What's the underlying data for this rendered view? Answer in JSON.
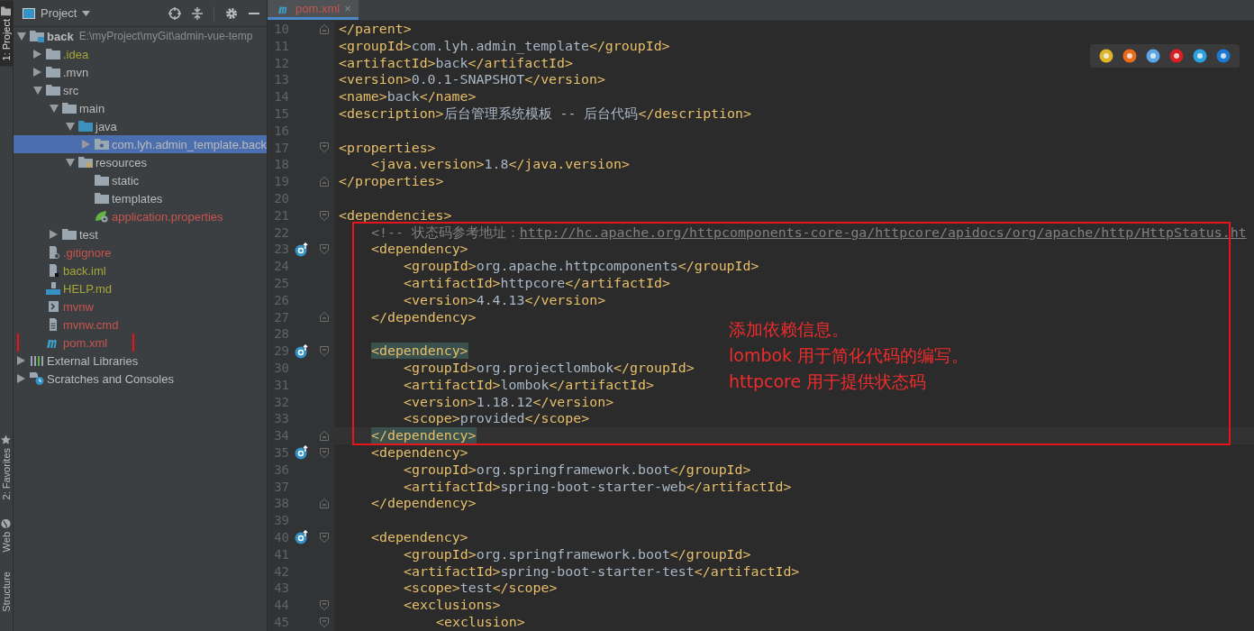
{
  "tool_strip": [
    {
      "label": "1: Project",
      "selected": true
    },
    {
      "label": "2: Favorites",
      "selected": false
    },
    {
      "label": "Web",
      "selected": false
    },
    {
      "label": "Structure",
      "selected": false
    }
  ],
  "project_panel": {
    "title": "Project",
    "tree": [
      {
        "label": "back",
        "path": "E:\\myProject\\myGit\\admin-vue-temp",
        "kind": "module",
        "color": "#bbbbbb",
        "expanded": true,
        "selected": false,
        "children": [
          {
            "label": ".idea",
            "kind": "folder",
            "color": "#a6a636",
            "expanded": false,
            "selected": false
          },
          {
            "label": ".mvn",
            "kind": "folder",
            "color": "#bbbbbb",
            "expanded": false,
            "selected": false
          },
          {
            "label": "src",
            "kind": "folder",
            "color": "#bbbbbb",
            "expanded": true,
            "selected": false,
            "children": [
              {
                "label": "main",
                "kind": "folder",
                "color": "#bbbbbb",
                "expanded": true,
                "selected": false,
                "children": [
                  {
                    "label": "java",
                    "kind": "source-folder",
                    "color": "#bbbbbb",
                    "expanded": true,
                    "selected": false,
                    "children": [
                      {
                        "label": "com.lyh.admin_template.back",
                        "kind": "package",
                        "color": "#bbbbbb",
                        "expanded": false,
                        "selected": true
                      }
                    ]
                  },
                  {
                    "label": "resources",
                    "kind": "resource-folder",
                    "color": "#bbbbbb",
                    "expanded": true,
                    "selected": false,
                    "children": [
                      {
                        "label": "static",
                        "kind": "folder",
                        "color": "#bbbbbb",
                        "selected": false
                      },
                      {
                        "label": "templates",
                        "kind": "folder",
                        "color": "#bbbbbb",
                        "selected": false
                      },
                      {
                        "label": "application.properties",
                        "kind": "spring-file",
                        "color": "#c75450",
                        "selected": false
                      }
                    ]
                  }
                ]
              },
              {
                "label": "test",
                "kind": "folder",
                "color": "#bbbbbb",
                "expanded": false,
                "selected": false
              }
            ]
          },
          {
            "label": ".gitignore",
            "kind": "ignore-file",
            "color": "#c75450",
            "selected": false
          },
          {
            "label": "back.iml",
            "kind": "iml-file",
            "color": "#a6a636",
            "selected": false
          },
          {
            "label": "HELP.md",
            "kind": "markdown-file",
            "color": "#a6a636",
            "selected": false
          },
          {
            "label": "mvnw",
            "kind": "script-file",
            "color": "#c75450",
            "selected": false
          },
          {
            "label": "mvnw.cmd",
            "kind": "text-file",
            "color": "#c75450",
            "selected": false
          },
          {
            "label": "pom.xml",
            "kind": "maven-file",
            "color": "#c75450",
            "selected": false,
            "marked": true
          }
        ]
      },
      {
        "label": "External Libraries",
        "kind": "libraries",
        "color": "#bbbbbb",
        "expanded": false,
        "selected": false
      },
      {
        "label": "Scratches and Consoles",
        "kind": "scratches",
        "color": "#bbbbbb",
        "expanded": false,
        "selected": false
      }
    ]
  },
  "editor_tabs": [
    {
      "label": "pom.xml",
      "close": "×",
      "selected": true
    }
  ],
  "code_lines": [
    {
      "n": "10",
      "fold_start": false,
      "fold_end": true,
      "gutter_icon": false,
      "current": false,
      "segs": [
        {
          "kind": "tag",
          "text": "</parent>"
        }
      ]
    },
    {
      "n": "11",
      "fold_start": false,
      "fold_end": false,
      "gutter_icon": false,
      "current": false,
      "segs": [
        {
          "kind": "tag",
          "text": "<groupId>"
        },
        {
          "kind": "text",
          "text": "com.lyh.admin_template"
        },
        {
          "kind": "tag",
          "text": "</groupId>"
        }
      ]
    },
    {
      "n": "12",
      "fold_start": false,
      "fold_end": false,
      "gutter_icon": false,
      "current": false,
      "segs": [
        {
          "kind": "tag",
          "text": "<artifactId>"
        },
        {
          "kind": "text",
          "text": "back"
        },
        {
          "kind": "tag",
          "text": "</artifactId>"
        }
      ]
    },
    {
      "n": "13",
      "fold_start": false,
      "fold_end": false,
      "gutter_icon": false,
      "current": false,
      "segs": [
        {
          "kind": "tag",
          "text": "<version>"
        },
        {
          "kind": "text",
          "text": "0.0.1-SNAPSHOT"
        },
        {
          "kind": "tag",
          "text": "</version>"
        }
      ]
    },
    {
      "n": "14",
      "fold_start": false,
      "fold_end": false,
      "gutter_icon": false,
      "current": false,
      "segs": [
        {
          "kind": "tag",
          "text": "<name>"
        },
        {
          "kind": "text",
          "text": "back"
        },
        {
          "kind": "tag",
          "text": "</name>"
        }
      ]
    },
    {
      "n": "15",
      "fold_start": false,
      "fold_end": false,
      "gutter_icon": false,
      "current": false,
      "segs": [
        {
          "kind": "tag",
          "text": "<description>"
        },
        {
          "kind": "text",
          "text": "后台管理系统模板 -- 后台代码"
        },
        {
          "kind": "tag",
          "text": "</description>"
        }
      ]
    },
    {
      "n": "16",
      "fold_start": false,
      "fold_end": false,
      "gutter_icon": false,
      "current": false
    },
    {
      "n": "17",
      "fold_start": true,
      "fold_end": false,
      "gutter_icon": false,
      "current": false,
      "segs": [
        {
          "kind": "tag",
          "text": "<properties>"
        }
      ],
      "children": [
        {
          "n": "18",
          "fold_start": false,
          "fold_end": false,
          "gutter_icon": false,
          "current": false,
          "segs": [
            {
              "kind": "tag",
              "text": "<java.version>"
            },
            {
              "kind": "text",
              "text": "1.8"
            },
            {
              "kind": "tag",
              "text": "</java.version>"
            }
          ]
        }
      ]
    },
    {
      "n": "19",
      "fold_start": false,
      "fold_end": true,
      "gutter_icon": false,
      "current": false,
      "segs": [
        {
          "kind": "tag",
          "text": "</properties>"
        }
      ]
    },
    {
      "n": "20",
      "fold_start": false,
      "fold_end": false,
      "gutter_icon": false,
      "current": false
    },
    {
      "n": "21",
      "fold_start": true,
      "fold_end": false,
      "gutter_icon": false,
      "current": false,
      "segs": [
        {
          "kind": "tag",
          "text": "<dependencies>"
        }
      ],
      "children": [
        {
          "n": "22",
          "fold_start": false,
          "fold_end": false,
          "gutter_icon": false,
          "current": false,
          "segs": [
            {
              "kind": "comment",
              "text": "<!-- 状态码参考地址："
            },
            {
              "kind": "link",
              "text": "http://hc.apache.org/httpcomponents-core-ga/httpcore/apidocs/org/apache/http/HttpStatus.ht"
            }
          ]
        },
        {
          "n": "23",
          "fold_start": true,
          "fold_end": false,
          "gutter_icon": true,
          "current": false,
          "segs": [
            {
              "kind": "tag",
              "text": "<dependency>"
            }
          ],
          "children": [
            {
              "n": "24",
              "fold_start": false,
              "fold_end": false,
              "gutter_icon": false,
              "current": false,
              "segs": [
                {
                  "kind": "tag",
                  "text": "<groupId>"
                },
                {
                  "kind": "text",
                  "text": "org.apache.httpcomponents"
                },
                {
                  "kind": "tag",
                  "text": "</groupId>"
                }
              ]
            },
            {
              "n": "25",
              "fold_start": false,
              "fold_end": false,
              "gutter_icon": false,
              "current": false,
              "segs": [
                {
                  "kind": "tag",
                  "text": "<artifactId>"
                },
                {
                  "kind": "text",
                  "text": "httpcore"
                },
                {
                  "kind": "tag",
                  "text": "</artifactId>"
                }
              ]
            },
            {
              "n": "26",
              "fold_start": false,
              "fold_end": false,
              "gutter_icon": false,
              "current": false,
              "segs": [
                {
                  "kind": "tag",
                  "text": "<version>"
                },
                {
                  "kind": "text",
                  "text": "4.4.13"
                },
                {
                  "kind": "tag",
                  "text": "</version>"
                }
              ]
            }
          ]
        },
        {
          "n": "27",
          "fold_start": false,
          "fold_end": true,
          "gutter_icon": false,
          "current": false,
          "segs": [
            {
              "kind": "tag",
              "text": "</dependency>"
            }
          ]
        },
        {
          "n": "28",
          "fold_start": false,
          "fold_end": false,
          "gutter_icon": false,
          "current": false
        },
        {
          "n": "29",
          "fold_start": true,
          "fold_end": false,
          "gutter_icon": true,
          "current": false,
          "segs": [
            {
              "kind": "tag-match",
              "text": "<dependency>"
            }
          ],
          "children": [
            {
              "n": "30",
              "fold_start": false,
              "fold_end": false,
              "gutter_icon": false,
              "current": false,
              "segs": [
                {
                  "kind": "tag",
                  "text": "<groupId>"
                },
                {
                  "kind": "text",
                  "text": "org.projectlombok"
                },
                {
                  "kind": "tag",
                  "text": "</groupId>"
                }
              ]
            },
            {
              "n": "31",
              "fold_start": false,
              "fold_end": false,
              "gutter_icon": false,
              "current": false,
              "segs": [
                {
                  "kind": "tag",
                  "text": "<artifactId>"
                },
                {
                  "kind": "text",
                  "text": "lombok"
                },
                {
                  "kind": "tag",
                  "text": "</artifactId>"
                }
              ]
            },
            {
              "n": "32",
              "fold_start": false,
              "fold_end": false,
              "gutter_icon": false,
              "current": false,
              "segs": [
                {
                  "kind": "tag",
                  "text": "<version>"
                },
                {
                  "kind": "text",
                  "text": "1.18.12"
                },
                {
                  "kind": "tag",
                  "text": "</version>"
                }
              ]
            },
            {
              "n": "33",
              "fold_start": false,
              "fold_end": false,
              "gutter_icon": false,
              "current": false,
              "segs": [
                {
                  "kind": "tag",
                  "text": "<scope>"
                },
                {
                  "kind": "text",
                  "text": "provided"
                },
                {
                  "kind": "tag",
                  "text": "</scope>"
                }
              ]
            }
          ]
        },
        {
          "n": "34",
          "fold_start": false,
          "fold_end": true,
          "gutter_icon": false,
          "current": true,
          "segs": [
            {
              "kind": "tag-match",
              "text": "</dependency>"
            }
          ]
        },
        {
          "n": "35",
          "fold_start": true,
          "fold_end": false,
          "gutter_icon": true,
          "current": false,
          "segs": [
            {
              "kind": "tag",
              "text": "<dependency>"
            }
          ],
          "children": [
            {
              "n": "36",
              "fold_start": false,
              "fold_end": false,
              "gutter_icon": false,
              "current": false,
              "segs": [
                {
                  "kind": "tag",
                  "text": "<groupId>"
                },
                {
                  "kind": "text",
                  "text": "org.springframework.boot"
                },
                {
                  "kind": "tag",
                  "text": "</groupId>"
                }
              ]
            },
            {
              "n": "37",
              "fold_start": false,
              "fold_end": false,
              "gutter_icon": false,
              "current": false,
              "segs": [
                {
                  "kind": "tag",
                  "text": "<artifactId>"
                },
                {
                  "kind": "text",
                  "text": "spring-boot-starter-web"
                },
                {
                  "kind": "tag",
                  "text": "</artifactId>"
                }
              ]
            }
          ]
        },
        {
          "n": "38",
          "fold_start": false,
          "fold_end": true,
          "gutter_icon": false,
          "current": false,
          "segs": [
            {
              "kind": "tag",
              "text": "</dependency>"
            }
          ]
        },
        {
          "n": "39",
          "fold_start": false,
          "fold_end": false,
          "gutter_icon": false,
          "current": false
        },
        {
          "n": "40",
          "fold_start": true,
          "fold_end": false,
          "gutter_icon": true,
          "current": false,
          "segs": [
            {
              "kind": "tag",
              "text": "<dependency>"
            }
          ],
          "children": [
            {
              "n": "41",
              "fold_start": false,
              "fold_end": false,
              "gutter_icon": false,
              "current": false,
              "segs": [
                {
                  "kind": "tag",
                  "text": "<groupId>"
                },
                {
                  "kind": "text",
                  "text": "org.springframework.boot"
                },
                {
                  "kind": "tag",
                  "text": "</groupId>"
                }
              ]
            },
            {
              "n": "42",
              "fold_start": false,
              "fold_end": false,
              "gutter_icon": false,
              "current": false,
              "segs": [
                {
                  "kind": "tag",
                  "text": "<artifactId>"
                },
                {
                  "kind": "text",
                  "text": "spring-boot-starter-test"
                },
                {
                  "kind": "tag",
                  "text": "</artifactId>"
                }
              ]
            },
            {
              "n": "43",
              "fold_start": false,
              "fold_end": false,
              "gutter_icon": false,
              "current": false,
              "segs": [
                {
                  "kind": "tag",
                  "text": "<scope>"
                },
                {
                  "kind": "text",
                  "text": "test"
                },
                {
                  "kind": "tag",
                  "text": "</scope>"
                }
              ]
            },
            {
              "n": "44",
              "fold_start": true,
              "fold_end": false,
              "gutter_icon": false,
              "current": false,
              "segs": [
                {
                  "kind": "tag",
                  "text": "<exclusions>"
                }
              ],
              "children": [
                {
                  "n": "45",
                  "fold_start": true,
                  "fold_end": false,
                  "gutter_icon": false,
                  "current": false,
                  "segs": [
                    {
                      "kind": "tag",
                      "text": "<exclusion>"
                    }
                  ]
                }
              ]
            }
          ]
        }
      ]
    }
  ],
  "annotation": {
    "lines": [
      "添加依赖信息。",
      "lombok 用于简化代码的编写。",
      "httpcore 用于提供状态码"
    ]
  }
}
